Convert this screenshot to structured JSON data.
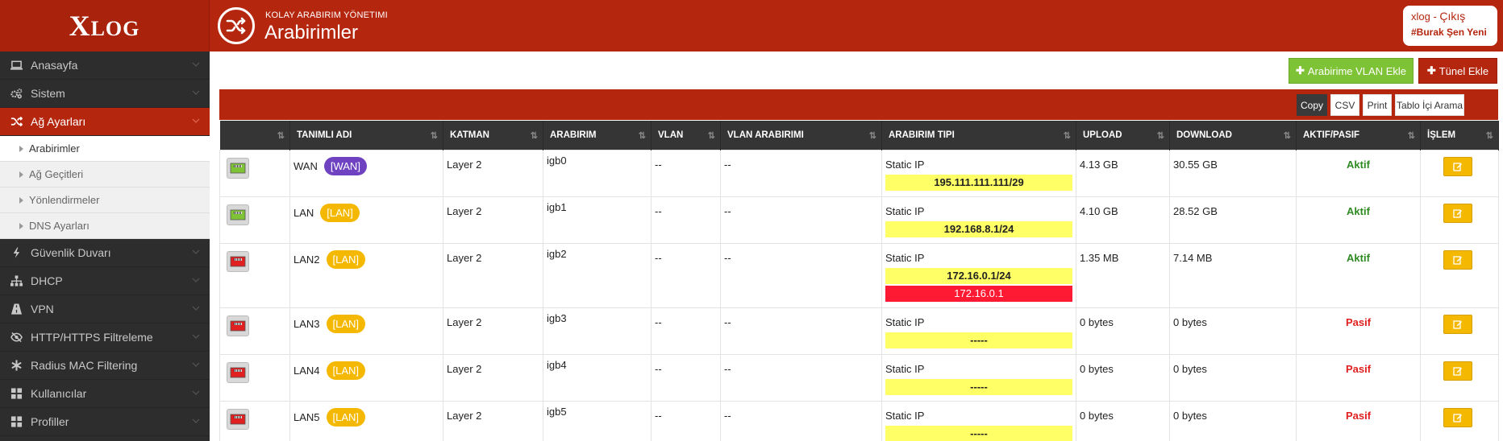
{
  "brand": {
    "logo_big": "X",
    "logo_rest": "LOG"
  },
  "header": {
    "subtitle": "KOLAY ARABIRIM YÖNETIMI",
    "title": "Arabirimler"
  },
  "user": {
    "name": "xlog",
    "separator": " - ",
    "logout": "Çıkış",
    "tag": "#Burak Şen Yeni"
  },
  "sidebar": {
    "items": [
      {
        "label": "Anasayfa",
        "icon": "laptop-icon"
      },
      {
        "label": "Sistem",
        "icon": "cogs-icon"
      },
      {
        "label": "Ağ Ayarları",
        "icon": "shuffle-icon",
        "active": true
      },
      {
        "label": "Güvenlik Duvarı",
        "icon": "bolt-icon"
      },
      {
        "label": "DHCP",
        "icon": "sitemap-icon"
      },
      {
        "label": "VPN",
        "icon": "road-icon"
      },
      {
        "label": "HTTP/HTTPS Filtreleme",
        "icon": "eye-slash-icon"
      },
      {
        "label": "Radius MAC Filtering",
        "icon": "asterisk-icon"
      },
      {
        "label": "Kullanıcılar",
        "icon": "grid-icon"
      },
      {
        "label": "Profiller",
        "icon": "grid-icon"
      }
    ],
    "subitems": [
      {
        "label": "Arabirimler",
        "active": true
      },
      {
        "label": "Ağ Geçitleri"
      },
      {
        "label": "Yönlendirmeler"
      },
      {
        "label": "DNS Ayarları"
      }
    ]
  },
  "actions": {
    "vlan_label": "Arabirime VLAN Ekle",
    "tunnel_label": "Tünel Ekle"
  },
  "toolbar": {
    "copy": "Copy",
    "csv": "CSV",
    "print": "Print",
    "search": "Tablo İçi Arama"
  },
  "table": {
    "headers": [
      "",
      "TANIMLI ADI",
      "KATMAN",
      "ARABIRIM",
      "VLAN",
      "VLAN ARABIRIMI",
      "ARABIRIM TIPI",
      "UPLOAD",
      "DOWNLOAD",
      "AKTIF/PASIF",
      "İŞLEM"
    ],
    "rows": [
      {
        "port_color": "green",
        "name": "WAN",
        "badge": "[WAN]",
        "badge_type": "wan",
        "layer": "Layer 2",
        "iface": "igb0",
        "vlan": "--",
        "vlan_iface": "--",
        "type": "Static IP",
        "ip": "195.111.111.111/29",
        "upload": "4.13 GB",
        "download": "30.55 GB",
        "status": "Aktif"
      },
      {
        "port_color": "green",
        "name": "LAN",
        "badge": "[LAN]",
        "badge_type": "lan",
        "layer": "Layer 2",
        "iface": "igb1",
        "vlan": "--",
        "vlan_iface": "--",
        "type": "Static IP",
        "ip": "192.168.8.1/24",
        "upload": "4.10 GB",
        "download": "28.52 GB",
        "status": "Aktif"
      },
      {
        "port_color": "red",
        "name": "LAN2",
        "badge": "[LAN]",
        "badge_type": "lan",
        "layer": "Layer 2",
        "iface": "igb2",
        "vlan": "--",
        "vlan_iface": "--",
        "type": "Static IP",
        "ip": "172.16.0.1/24",
        "ip_extra": "172.16.0.1",
        "upload": "1.35 MB",
        "download": "7.14 MB",
        "status": "Aktif"
      },
      {
        "port_color": "red",
        "name": "LAN3",
        "badge": "[LAN]",
        "badge_type": "lan",
        "layer": "Layer 2",
        "iface": "igb3",
        "vlan": "--",
        "vlan_iface": "--",
        "type": "Static IP",
        "ip": "-----",
        "upload": "0 bytes",
        "download": "0 bytes",
        "status": "Pasif"
      },
      {
        "port_color": "red",
        "name": "LAN4",
        "badge": "[LAN]",
        "badge_type": "lan",
        "layer": "Layer 2",
        "iface": "igb4",
        "vlan": "--",
        "vlan_iface": "--",
        "type": "Static IP",
        "ip": "-----",
        "upload": "0 bytes",
        "download": "0 bytes",
        "status": "Pasif"
      },
      {
        "port_color": "red",
        "name": "LAN5",
        "badge": "[LAN]",
        "badge_type": "lan",
        "layer": "Layer 2",
        "iface": "igb5",
        "vlan": "--",
        "vlan_iface": "--",
        "type": "Static IP",
        "ip": "-----",
        "upload": "0 bytes",
        "download": "0 bytes",
        "status": "Pasif"
      }
    ]
  },
  "colors": {
    "brand": "#b5260e",
    "sidebar": "#2d2d2d",
    "green_btn": "#7ec235",
    "aktif": "#2e8b22",
    "pasif": "#e02020",
    "ip_bg": "#ffff66",
    "ip_red": "#ff1a33",
    "wan_badge": "#6f42c1",
    "lan_badge": "#f5b800"
  }
}
